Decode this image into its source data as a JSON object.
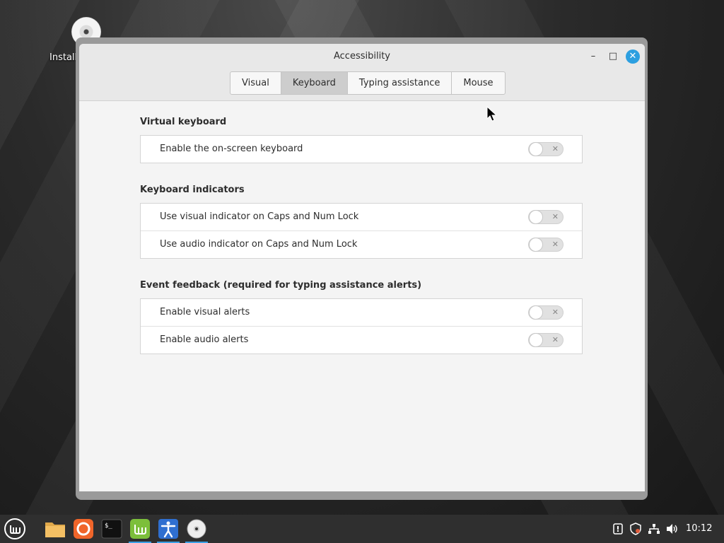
{
  "desktop": {
    "icon_label": "Install"
  },
  "window": {
    "title": "Accessibility",
    "controls": {
      "minimize": "–",
      "maximize": "□",
      "close": "✕"
    }
  },
  "tabs": [
    {
      "label": "Visual",
      "active": false
    },
    {
      "label": "Keyboard",
      "active": true
    },
    {
      "label": "Typing assistance",
      "active": false
    },
    {
      "label": "Mouse",
      "active": false
    }
  ],
  "sections": [
    {
      "title": "Virtual keyboard",
      "rows": [
        {
          "label": "Enable the on-screen keyboard",
          "enabled": false
        }
      ]
    },
    {
      "title": "Keyboard indicators",
      "rows": [
        {
          "label": "Use visual indicator on Caps and Num Lock",
          "enabled": false
        },
        {
          "label": "Use audio indicator on Caps and Num Lock",
          "enabled": false
        }
      ]
    },
    {
      "title": "Event feedback (required for typing assistance alerts)",
      "rows": [
        {
          "label": "Enable visual alerts",
          "enabled": false
        },
        {
          "label": "Enable audio alerts",
          "enabled": false
        }
      ]
    }
  ],
  "toggle_off_glyph": "✕",
  "taskbar": {
    "clock": "10:12",
    "apps": [
      "menu-icon",
      "files-icon",
      "firefox-icon",
      "terminal-icon",
      "mintinstall-icon",
      "accessibility-icon",
      "disc-icon"
    ],
    "tray": [
      "update-icon",
      "shield-icon",
      "network-icon",
      "volume-icon"
    ]
  },
  "colors": {
    "accent": "#2c9fe0",
    "active_tab": "#cdcdcd",
    "mint_green": "#7cbf3b",
    "firefox_orange": "#f0652a"
  }
}
